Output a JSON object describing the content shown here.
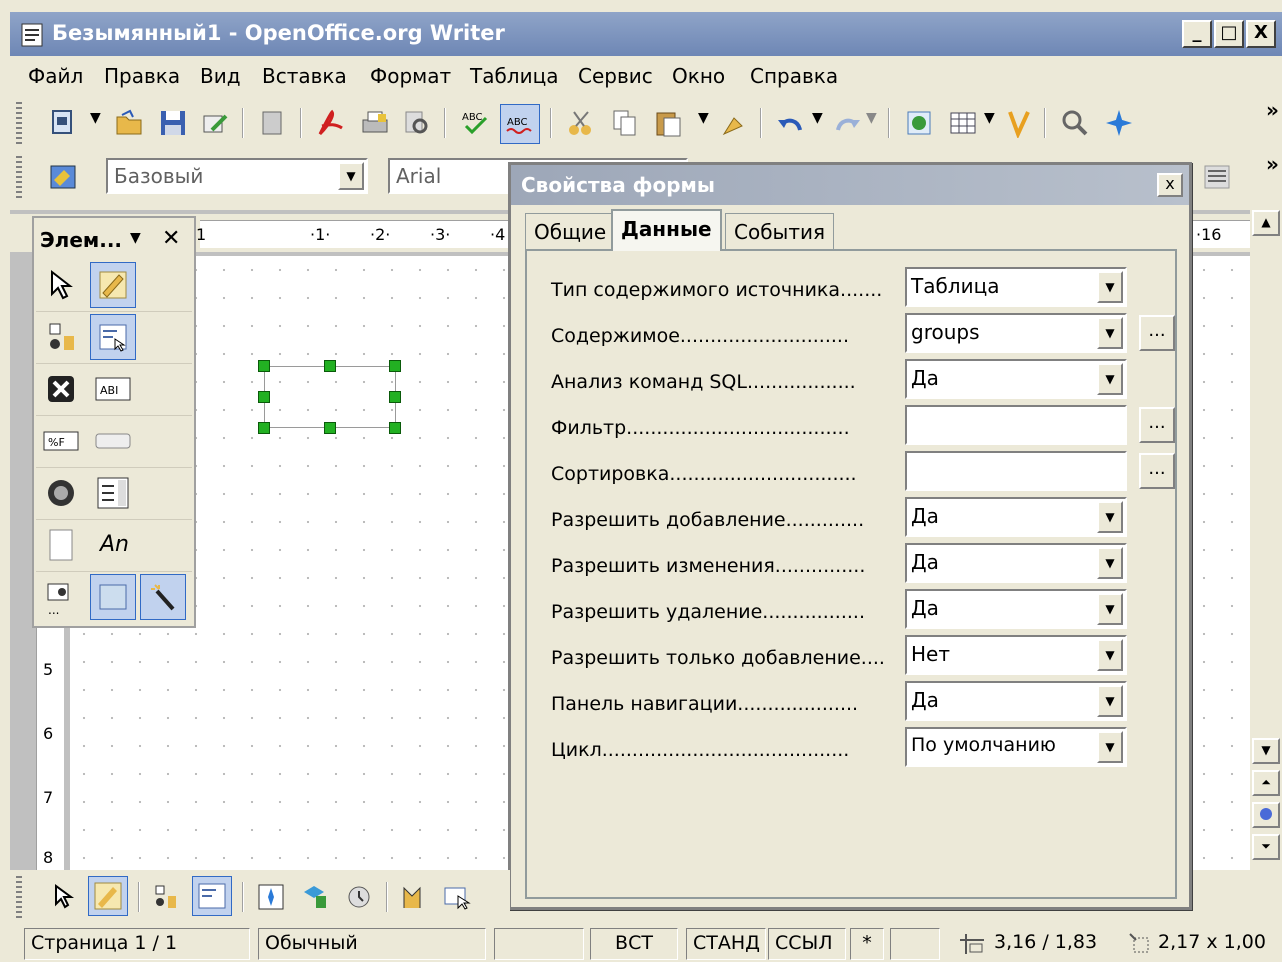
{
  "window": {
    "title": "Безымянный1 - OpenOffice.org Writer",
    "min": "_",
    "max": "□",
    "close": "X"
  },
  "menu": [
    "Файл",
    "Правка",
    "Вид",
    "Вставка",
    "Формат",
    "Таблица",
    "Сервис",
    "Окно",
    "Справка"
  ],
  "format_toolbar": {
    "style": "Базовый",
    "font": "Arial",
    "more": "»"
  },
  "toolbar_more": "»",
  "ruler": {
    "h": [
      "1",
      "·1·",
      "·2·",
      "·3·",
      "·4",
      "·16"
    ],
    "v": [
      "5",
      "6",
      "7",
      "8"
    ]
  },
  "elements_panel": {
    "title": "Элем...",
    "menu": "▼",
    "close": "✕",
    "label_text": "An"
  },
  "dialog": {
    "title": "Свойства формы",
    "close": "x",
    "tabs": [
      "Общие",
      "Данные",
      "События"
    ],
    "active_tab": 1,
    "ellipsis": "...",
    "rows": [
      {
        "label": "Тип содержимого источника.......",
        "value": "Таблица"
      },
      {
        "label": "Содержимое............................",
        "value": "groups"
      },
      {
        "label": "Анализ команд SQL..................",
        "value": "Да"
      },
      {
        "label": "Фильтр.....................................",
        "value": ""
      },
      {
        "label": "Сортировка...............................",
        "value": ""
      },
      {
        "label": "Разрешить добавление.............",
        "value": "Да"
      },
      {
        "label": "Разрешить изменения...............",
        "value": "Да"
      },
      {
        "label": "Разрешить удаление.................",
        "value": "Да"
      },
      {
        "label": "Разрешить только добавление....",
        "value": "Нет"
      },
      {
        "label": "Панель навигации....................",
        "value": "Да"
      },
      {
        "label": "Цикл.........................................",
        "value": "По умолчанию"
      }
    ]
  },
  "statusbar": {
    "page": "Страница  1 / 1",
    "style": "Обычный",
    "insert": "ВСТ",
    "select": "СТАНД",
    "hyper": "ССЫЛ",
    "modified": "*",
    "position": "3,16 / 1,83",
    "size": "2,17 x 1,00"
  },
  "colors": {
    "title_bg": "#7b91bd",
    "dialog_title_bg": "#a8b0c0",
    "selection_handle": "#22b022"
  }
}
